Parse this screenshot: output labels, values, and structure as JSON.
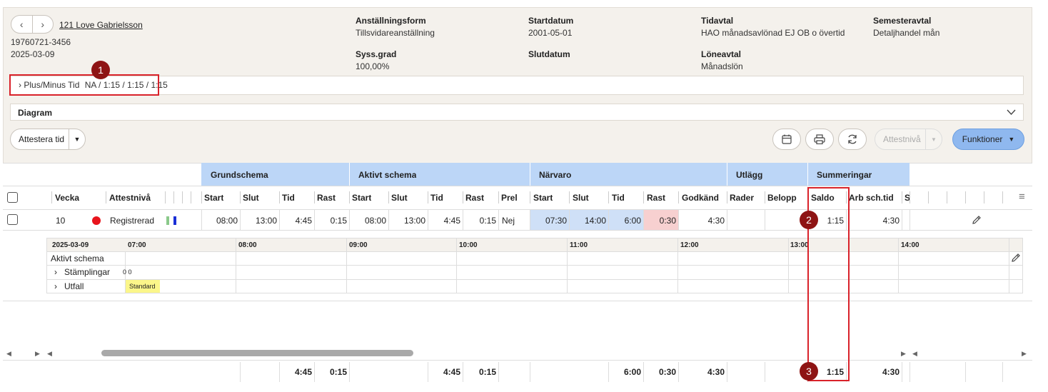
{
  "employee": {
    "name": "121 Love Gabrielsson",
    "id": "19760721-3456",
    "date": "2025-03-09"
  },
  "info": [
    {
      "label": "Anställningsform",
      "value": "Tillsvidareanställning"
    },
    {
      "label": "Startdatum",
      "value": "2001-05-01"
    },
    {
      "label": "Tidavtal",
      "value": "HAO månadsavlönad EJ OB o övertid"
    },
    {
      "label": "Semesteravtal",
      "value": "Detaljhandel mån"
    },
    {
      "label": "Syss.grad",
      "value": "100,00%"
    },
    {
      "label": "Slutdatum",
      "value": ""
    },
    {
      "label": "Löneavtal",
      "value": "Månadslön"
    }
  ],
  "plusminus": {
    "label": "Plus/Minus Tid",
    "value": "NA / 1:15 / 1:15 / 1:15"
  },
  "diagram": {
    "label": "Diagram"
  },
  "toolbar": {
    "attest_label": "Attestera tid",
    "attest_level_label": "Attestnivå",
    "functions_label": "Funktioner"
  },
  "badges": [
    "1",
    "2",
    "3"
  ],
  "groups": [
    "Grundschema",
    "Aktivt schema",
    "Närvaro",
    "Utlägg",
    "Summeringar"
  ],
  "columns": [
    "Vecka",
    "Attestnivå",
    "Start",
    "Slut",
    "Tid",
    "Rast",
    "Start",
    "Slut",
    "Tid",
    "Rast",
    "Prel",
    "Start",
    "Slut",
    "Tid",
    "Rast",
    "Godkänd",
    "Rader",
    "Belopp",
    "Saldo",
    "Arb sch.tid",
    "S"
  ],
  "row": {
    "week": "10",
    "status": "Registrerad",
    "values": [
      "08:00",
      "13:00",
      "4:45",
      "0:15",
      "08:00",
      "13:00",
      "4:45",
      "0:15",
      "Nej",
      "07:30",
      "14:00",
      "6:00",
      "0:30",
      "4:30",
      "",
      "",
      "1:15",
      "4:30"
    ]
  },
  "timeline": {
    "date": "2025-03-09",
    "hours": [
      "07:00",
      "08:00",
      "09:00",
      "10:00",
      "11:00",
      "12:00",
      "13:00",
      "14:00"
    ],
    "rows": [
      "Aktivt schema",
      "Stämplingar",
      "Utfall"
    ],
    "stamp_text": "0 0",
    "utfall_tag": "Standard"
  },
  "totals": [
    "4:45",
    "0:15",
    "4:45",
    "0:15",
    "6:00",
    "0:30",
    "4:30",
    "1:15",
    "4:30"
  ],
  "colors": {
    "accent": "#8fb8ef",
    "group_header": "#bcd6f7",
    "red": "#d9222a",
    "badge": "#8e1414",
    "status_dot": "#e8141c"
  }
}
